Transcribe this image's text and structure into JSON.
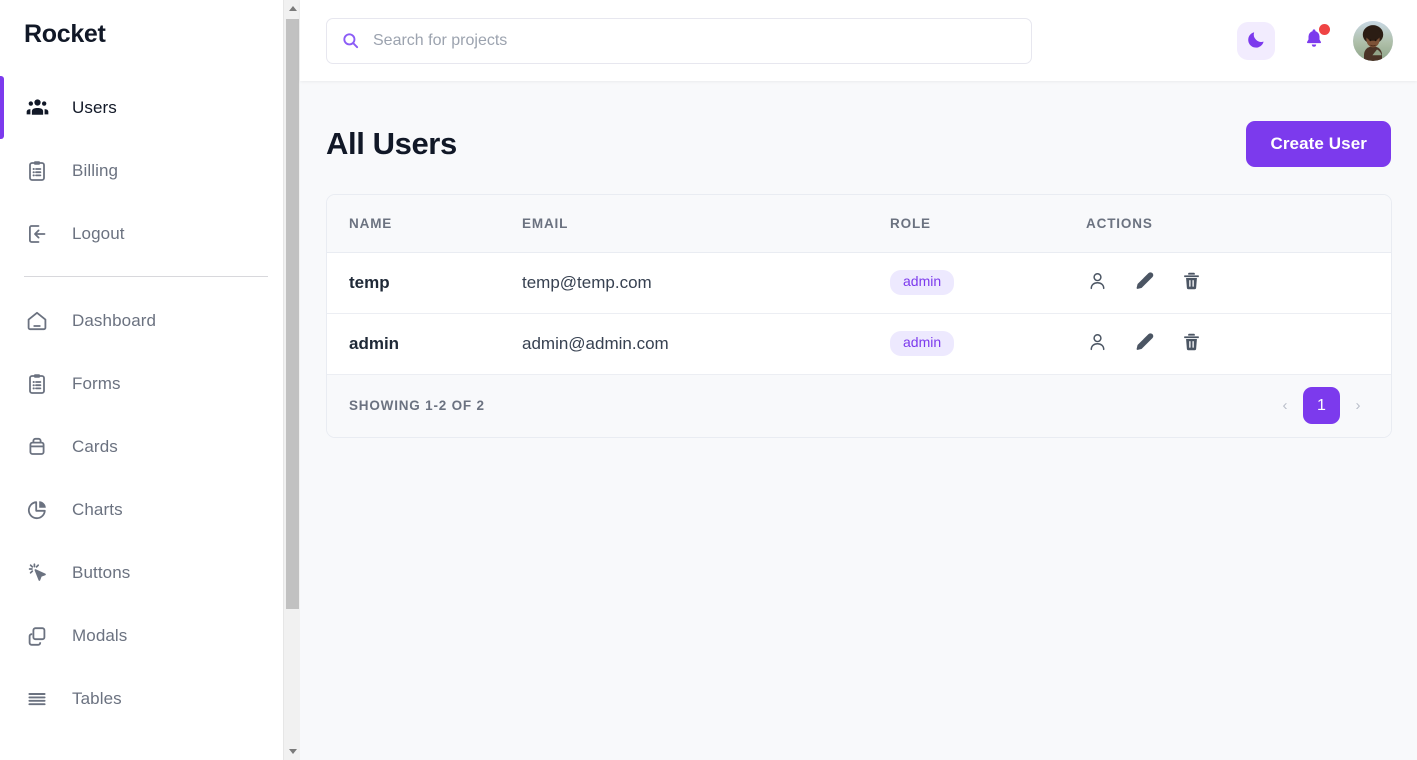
{
  "sidebar": {
    "brand": "Rocket",
    "primary_items": [
      {
        "label": "Users",
        "icon": "users-icon",
        "active": true
      },
      {
        "label": "Billing",
        "icon": "clipboard-icon",
        "active": false
      },
      {
        "label": "Logout",
        "icon": "logout-icon",
        "active": false
      }
    ],
    "secondary_items": [
      {
        "label": "Dashboard",
        "icon": "home-icon"
      },
      {
        "label": "Forms",
        "icon": "clipboard-list-icon"
      },
      {
        "label": "Cards",
        "icon": "box-icon"
      },
      {
        "label": "Charts",
        "icon": "pie-chart-icon"
      },
      {
        "label": "Buttons",
        "icon": "cursor-click-icon"
      },
      {
        "label": "Modals",
        "icon": "copy-icon"
      },
      {
        "label": "Tables",
        "icon": "table-rows-icon"
      }
    ]
  },
  "topbar": {
    "search": {
      "placeholder": "Search for projects",
      "value": "",
      "icon": "search-icon"
    },
    "theme_toggle_icon": "moon-icon",
    "notifications_icon": "bell-icon",
    "notification_badge": true,
    "avatar_label": "user-avatar"
  },
  "main": {
    "title": "All Users",
    "create_button": "Create User",
    "table": {
      "columns": [
        "NAME",
        "EMAIL",
        "ROLE",
        "ACTIONS"
      ],
      "rows": [
        {
          "name": "temp",
          "email": "temp@temp.com",
          "role": "admin"
        },
        {
          "name": "admin",
          "email": "admin@admin.com",
          "role": "admin"
        }
      ],
      "row_actions": [
        {
          "icon": "person-icon",
          "name": "view-user-button"
        },
        {
          "icon": "pencil-icon",
          "name": "edit-user-button"
        },
        {
          "icon": "trash-icon",
          "name": "delete-user-button"
        }
      ],
      "footer": {
        "showing": "SHOWING 1-2 OF 2",
        "prev": "‹",
        "next": "›",
        "current_page": "1"
      }
    }
  },
  "colors": {
    "accent": "#7c3aed",
    "accent_light": "#ede9fe",
    "badge_red": "#ef4444",
    "page_bg": "#f8f9fb",
    "text_muted": "#6b7280"
  }
}
